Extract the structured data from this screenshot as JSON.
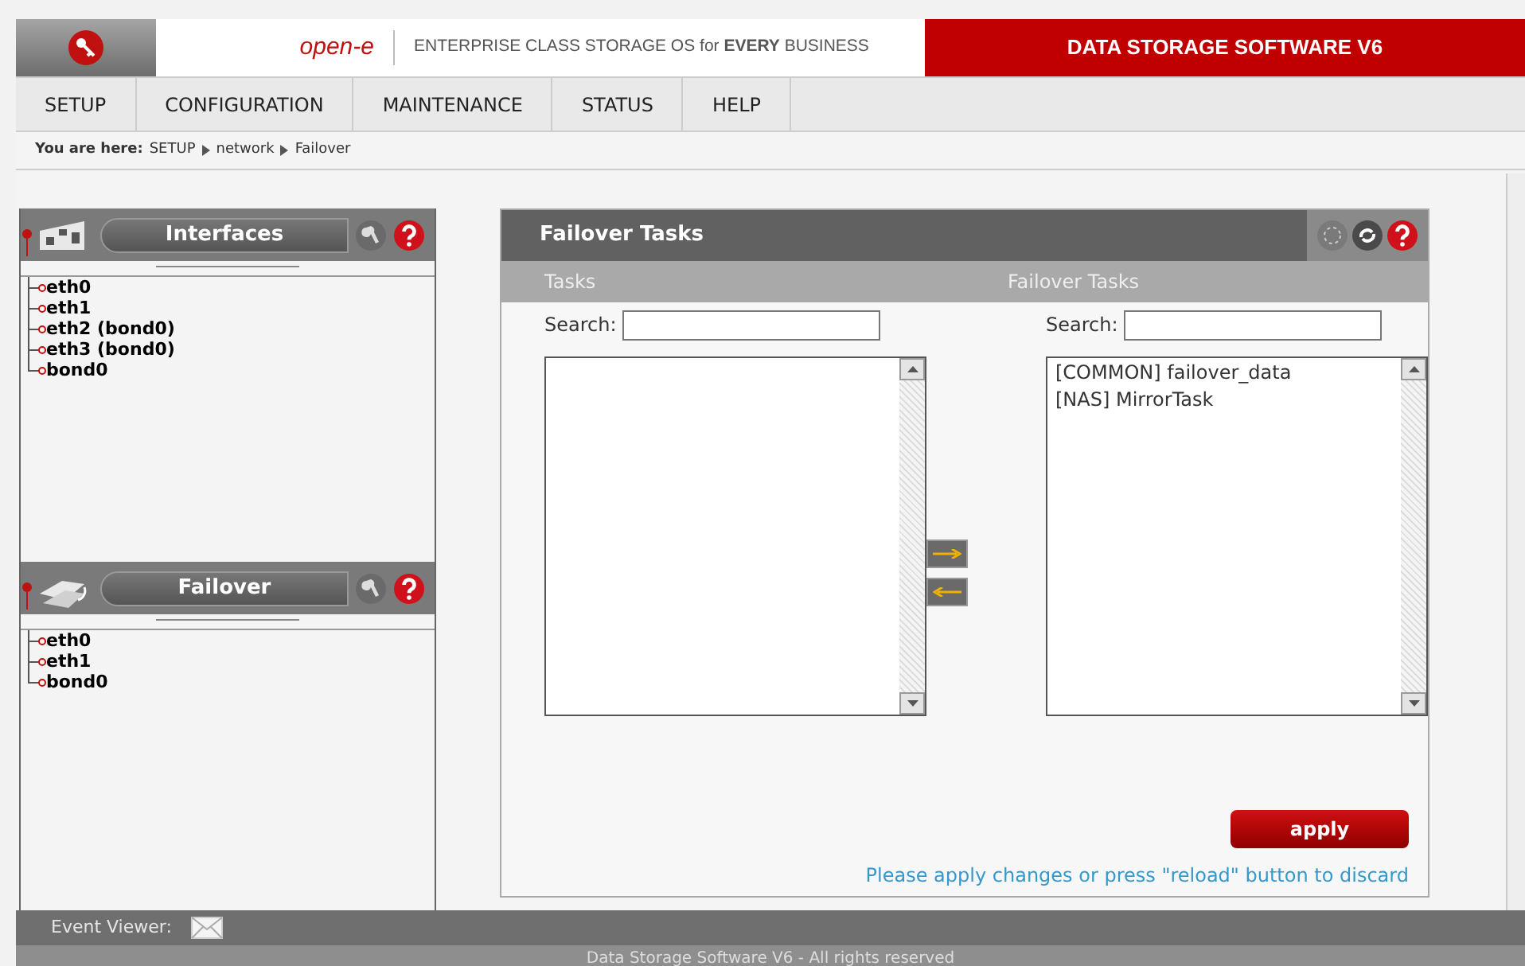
{
  "header": {
    "logo_text": "open-e",
    "tagline": "ENTERPRISE CLASS STORAGE OS for **EVERY** BUSINESS",
    "product": "DATA STORAGE SOFTWARE **V6**"
  },
  "menu": [
    {
      "label": "SETUP"
    },
    {
      "label": "CONFIGURATION"
    },
    {
      "label": "MAINTENANCE"
    },
    {
      "label": "STATUS"
    },
    {
      "label": "HELP"
    }
  ],
  "breadcrumb": {
    "label": "You are here:",
    "path": [
      "SETUP",
      "network",
      "Failover"
    ]
  },
  "sidebar": [
    {
      "kind": "interfaces",
      "title": "Interfaces",
      "items": [
        "eth0",
        "eth1",
        "eth2 (bond0)",
        "eth3 (bond0)",
        "bond0"
      ]
    },
    {
      "kind": "failover",
      "title": "Failover",
      "items": [
        "eth0",
        "eth1",
        "bond0"
      ]
    }
  ],
  "panel": {
    "title": "Failover Tasks",
    "columns": [
      {
        "header": "Tasks",
        "search_label": "Search:"
      },
      {
        "header": "Failover Tasks",
        "search_label": "Search:",
        "items": [
          "[COMMON] failover_data",
          "[NAS] MirrorTask"
        ]
      }
    ],
    "apply": "apply",
    "note": "Please apply changes or press \"reload\" button to discard"
  },
  "event_viewer": "Event Viewer:",
  "footer": "Data Storage Software V6 - All rights reserved"
}
